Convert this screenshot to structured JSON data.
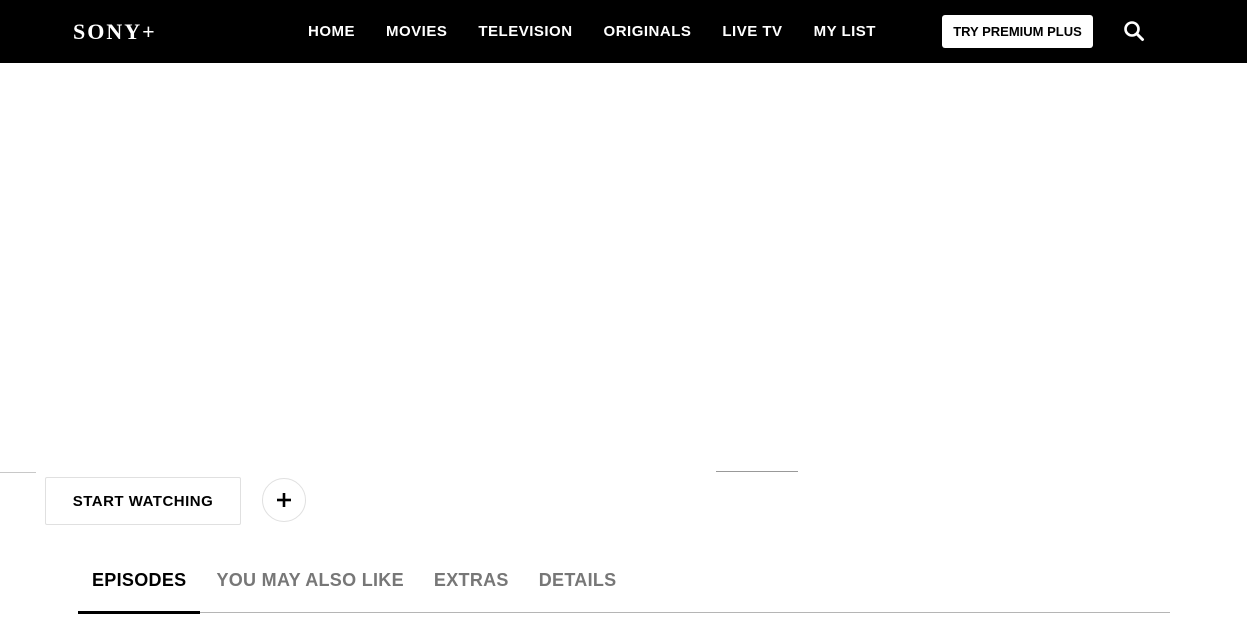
{
  "header": {
    "logo": "SONY+",
    "nav": [
      "HOME",
      "MOVIES",
      "TELEVISION",
      "ORIGINALS",
      "LIVE TV",
      "MY LIST"
    ],
    "premium_label": "TRY PREMIUM PLUS",
    "search_icon": "search-icon"
  },
  "actions": {
    "start_label": "START WATCHING",
    "add_icon": "plus-icon"
  },
  "tabs": {
    "items": [
      "EPISODES",
      "YOU MAY ALSO LIKE",
      "EXTRAS",
      "DETAILS"
    ],
    "active": "EPISODES"
  },
  "colors": {
    "header_bg": "#000000",
    "accent": "#000000",
    "tab_inactive": "#777777"
  }
}
